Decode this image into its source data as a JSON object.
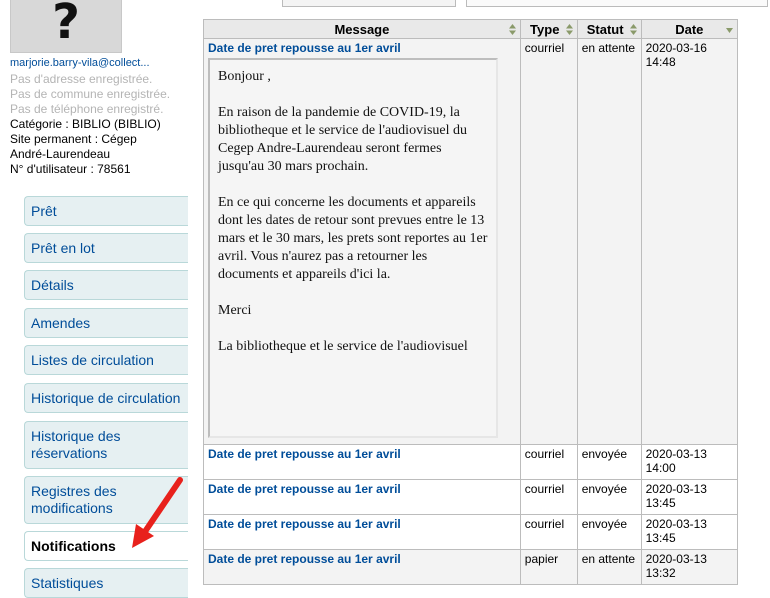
{
  "patron": {
    "photo_placeholder": "?",
    "email": "marjorie.barry-vila@collect...",
    "no_address": "Pas d'adresse enregistrée.",
    "no_city": "Pas de commune enregistrée.",
    "no_phone": "Pas de téléphone enregistré.",
    "category": "Catégorie : BIBLIO (BIBLIO)",
    "library_line1": "Site permanent : Cégep",
    "library_line2": "André-Laurendeau",
    "user_number": "N° d'utilisateur : 78561"
  },
  "nav": {
    "items": [
      {
        "label": "Prêt"
      },
      {
        "label": "Prêt en lot"
      },
      {
        "label": "Détails"
      },
      {
        "label": "Amendes"
      },
      {
        "label": "Listes de circulation"
      },
      {
        "label": "Historique de circulation"
      },
      {
        "label": "Historique des réservations"
      },
      {
        "label": "Registres des modifications"
      },
      {
        "label": "Notifications"
      },
      {
        "label": "Statistiques"
      }
    ],
    "active": "Notifications"
  },
  "annotation": {
    "arrow_color": "#e8211c"
  },
  "table": {
    "headers": {
      "message": "Message",
      "type": "Type",
      "status": "Statut",
      "date": "Date"
    },
    "expanded_message": {
      "greeting": "Bonjour ,",
      "p1": "En raison de la pandemie de COVID-19, la bibliotheque et le service de l'audiovisuel du Cegep Andre-Laurendeau seront fermes jusqu'au 30 mars prochain.",
      "p2": "En ce qui concerne les documents et appareils dont les dates de retour sont prevues entre le 13 mars et le 30 mars, les prets sont reportes au 1er avril. Vous n'aurez pas a retourner les documents et appareils d'ici la.",
      "p3": "Merci",
      "p4": "La bibliotheque et le service de l'audiovisuel"
    },
    "rows": [
      {
        "subject": "Date de pret repousse au 1er avril",
        "type": "courriel",
        "status": "en attente",
        "date": "2020-03-16 14:48"
      },
      {
        "subject": "Date de pret repousse au 1er avril",
        "type": "courriel",
        "status": "envoyée",
        "date": "2020-03-13 14:00"
      },
      {
        "subject": "Date de pret repousse au 1er avril",
        "type": "courriel",
        "status": "envoyée",
        "date": "2020-03-13 13:45"
      },
      {
        "subject": "Date de pret repousse au 1er avril",
        "type": "courriel",
        "status": "envoyée",
        "date": "2020-03-13 13:45"
      },
      {
        "subject": "Date de pret repousse au 1er avril",
        "type": "papier",
        "status": "en attente",
        "date": "2020-03-13 13:32"
      }
    ]
  }
}
